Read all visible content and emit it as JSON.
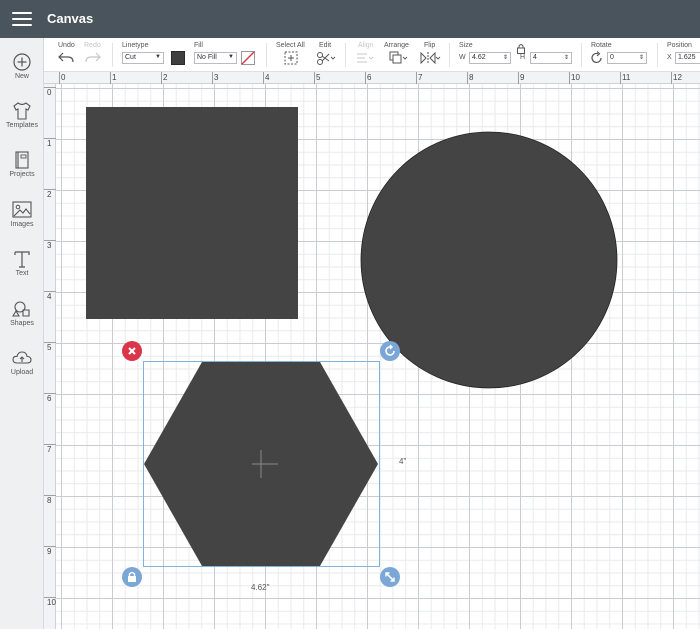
{
  "app": {
    "title": "Canvas"
  },
  "sidebar": {
    "items": [
      {
        "label": "New"
      },
      {
        "label": "Templates"
      },
      {
        "label": "Projects"
      },
      {
        "label": "Images"
      },
      {
        "label": "Text"
      },
      {
        "label": "Shapes"
      },
      {
        "label": "Upload"
      }
    ]
  },
  "toolbar": {
    "undo_label": "Undo",
    "redo_label": "Redo",
    "linetype_label": "Linetype",
    "linetype_value": "Cut",
    "fill_label": "Fill",
    "fill_value": "No Fill",
    "select_all_label": "Select All",
    "edit_label": "Edit",
    "align_label": "Align",
    "arrange_label": "Arrange",
    "flip_label": "Flip",
    "size_label": "Size",
    "width_prefix": "W",
    "width_value": "4.62",
    "height_prefix": "H",
    "height_value": "4",
    "rotate_label": "Rotate",
    "rotate_value": "0",
    "position_label": "Position",
    "x_prefix": "X",
    "x_value": "1.625",
    "linetype_color": "#3f3f3f"
  },
  "rulers": {
    "horizontal": [
      "0",
      "1",
      "2",
      "3",
      "4",
      "5",
      "6",
      "7",
      "8",
      "9",
      "10",
      "11",
      "12"
    ],
    "vertical": [
      "0",
      "1",
      "2",
      "3",
      "4",
      "5",
      "6",
      "7",
      "8",
      "9",
      "10"
    ]
  },
  "selection": {
    "width_label": "4.62\"",
    "height_label": "4\""
  },
  "colors": {
    "shape_fill": "#444444",
    "delete_handle": "#d9364a",
    "handle_blue": "#7aa7d6",
    "titlebar": "#4a545c"
  },
  "icons": {
    "menu": "hamburger-menu-icon",
    "new": "plus-circle-icon",
    "templates": "tshirt-icon",
    "projects": "book-icon",
    "images": "image-icon",
    "text": "text-t-icon",
    "shapes": "shapes-icon",
    "upload": "cloud-upload-icon"
  }
}
